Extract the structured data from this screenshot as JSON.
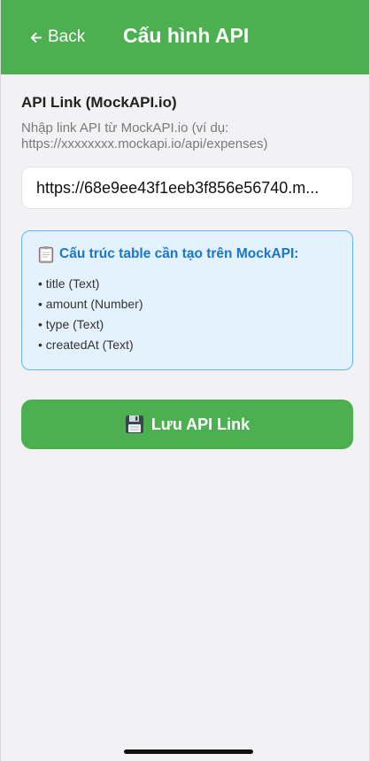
{
  "header": {
    "back_label": "Back",
    "title": "Cấu hình API",
    "background_color": "#4caf50"
  },
  "form": {
    "label": "API Link (MockAPI.io)",
    "hint": "Nhập link API từ MockAPI.io (ví dụ: https://xxxxxxxx.mockapi.io/api/expenses)",
    "input_value": "https://68e9ee43f1eeb3f856e56740.m..."
  },
  "info": {
    "title": "Cấu trúc table cần tạo trên MockAPI:",
    "fields": [
      "title (Text)",
      "amount (Number)",
      "type (Text)",
      "createdAt (Text)"
    ]
  },
  "save_button": {
    "label": "Lưu API Link",
    "color": "#4caf50"
  }
}
